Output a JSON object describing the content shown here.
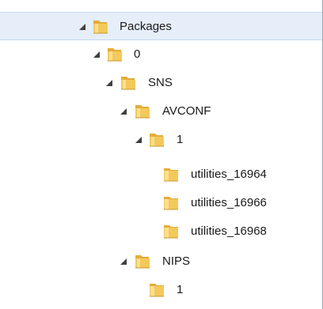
{
  "tree": {
    "nodes": [
      {
        "label": "Packages",
        "expanded": true,
        "selected": true,
        "icon": "folder-open-icon"
      },
      {
        "label": "0",
        "expanded": true,
        "selected": false,
        "icon": "folder-open-icon"
      },
      {
        "label": "SNS",
        "expanded": true,
        "selected": false,
        "icon": "folder-open-icon"
      },
      {
        "label": "AVCONF",
        "expanded": true,
        "selected": false,
        "icon": "folder-open-icon"
      },
      {
        "label": "1",
        "expanded": true,
        "selected": false,
        "icon": "folder-open-icon"
      },
      {
        "label": "utilities_16964",
        "expanded": null,
        "selected": false,
        "icon": "folder-icon"
      },
      {
        "label": "utilities_16966",
        "expanded": null,
        "selected": false,
        "icon": "folder-icon"
      },
      {
        "label": "utilities_16968",
        "expanded": null,
        "selected": false,
        "icon": "folder-icon"
      },
      {
        "label": "NIPS",
        "expanded": true,
        "selected": false,
        "icon": "folder-open-icon"
      },
      {
        "label": "1",
        "expanded": null,
        "selected": false,
        "icon": "folder-icon"
      }
    ]
  },
  "colors": {
    "selection_background": "#e6eef9",
    "folder_yellow": "#f3c95a",
    "expander_dark": "#404040"
  }
}
